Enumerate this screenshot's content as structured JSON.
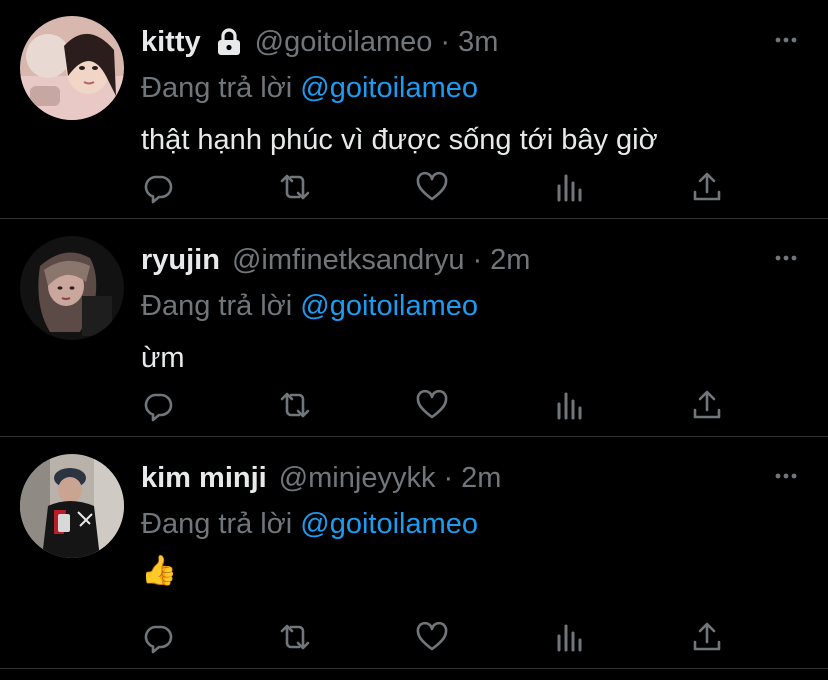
{
  "colors": {
    "background": "#000000",
    "text_primary": "#e7e9ea",
    "text_secondary": "#71767b",
    "accent": "#1d9bf0",
    "divider": "#2f3336"
  },
  "tweets": [
    {
      "name": "kitty",
      "protected_icon": "lock-icon",
      "handle": "@goitoilameo",
      "separator": "·",
      "time": "3m",
      "reply_prefix": "Đang trả lời",
      "reply_to": "@goitoilameo",
      "text": "thật hạnh phúc vì được sống tới bây giờ"
    },
    {
      "name": "ryujin",
      "handle": "@imfinetksandryu",
      "separator": "·",
      "time": "2m",
      "reply_prefix": "Đang trả lời",
      "reply_to": "@goitoilameo",
      "text": "ừm"
    },
    {
      "name": "kim minji",
      "handle": "@minjeyykk",
      "separator": "·",
      "time": "2m",
      "reply_prefix": "Đang trả lời",
      "reply_to": "@goitoilameo",
      "text": "👍"
    }
  ],
  "action_icons": [
    "reply-icon",
    "retweet-icon",
    "like-icon",
    "views-icon",
    "share-icon"
  ],
  "more_icon": "more-icon"
}
